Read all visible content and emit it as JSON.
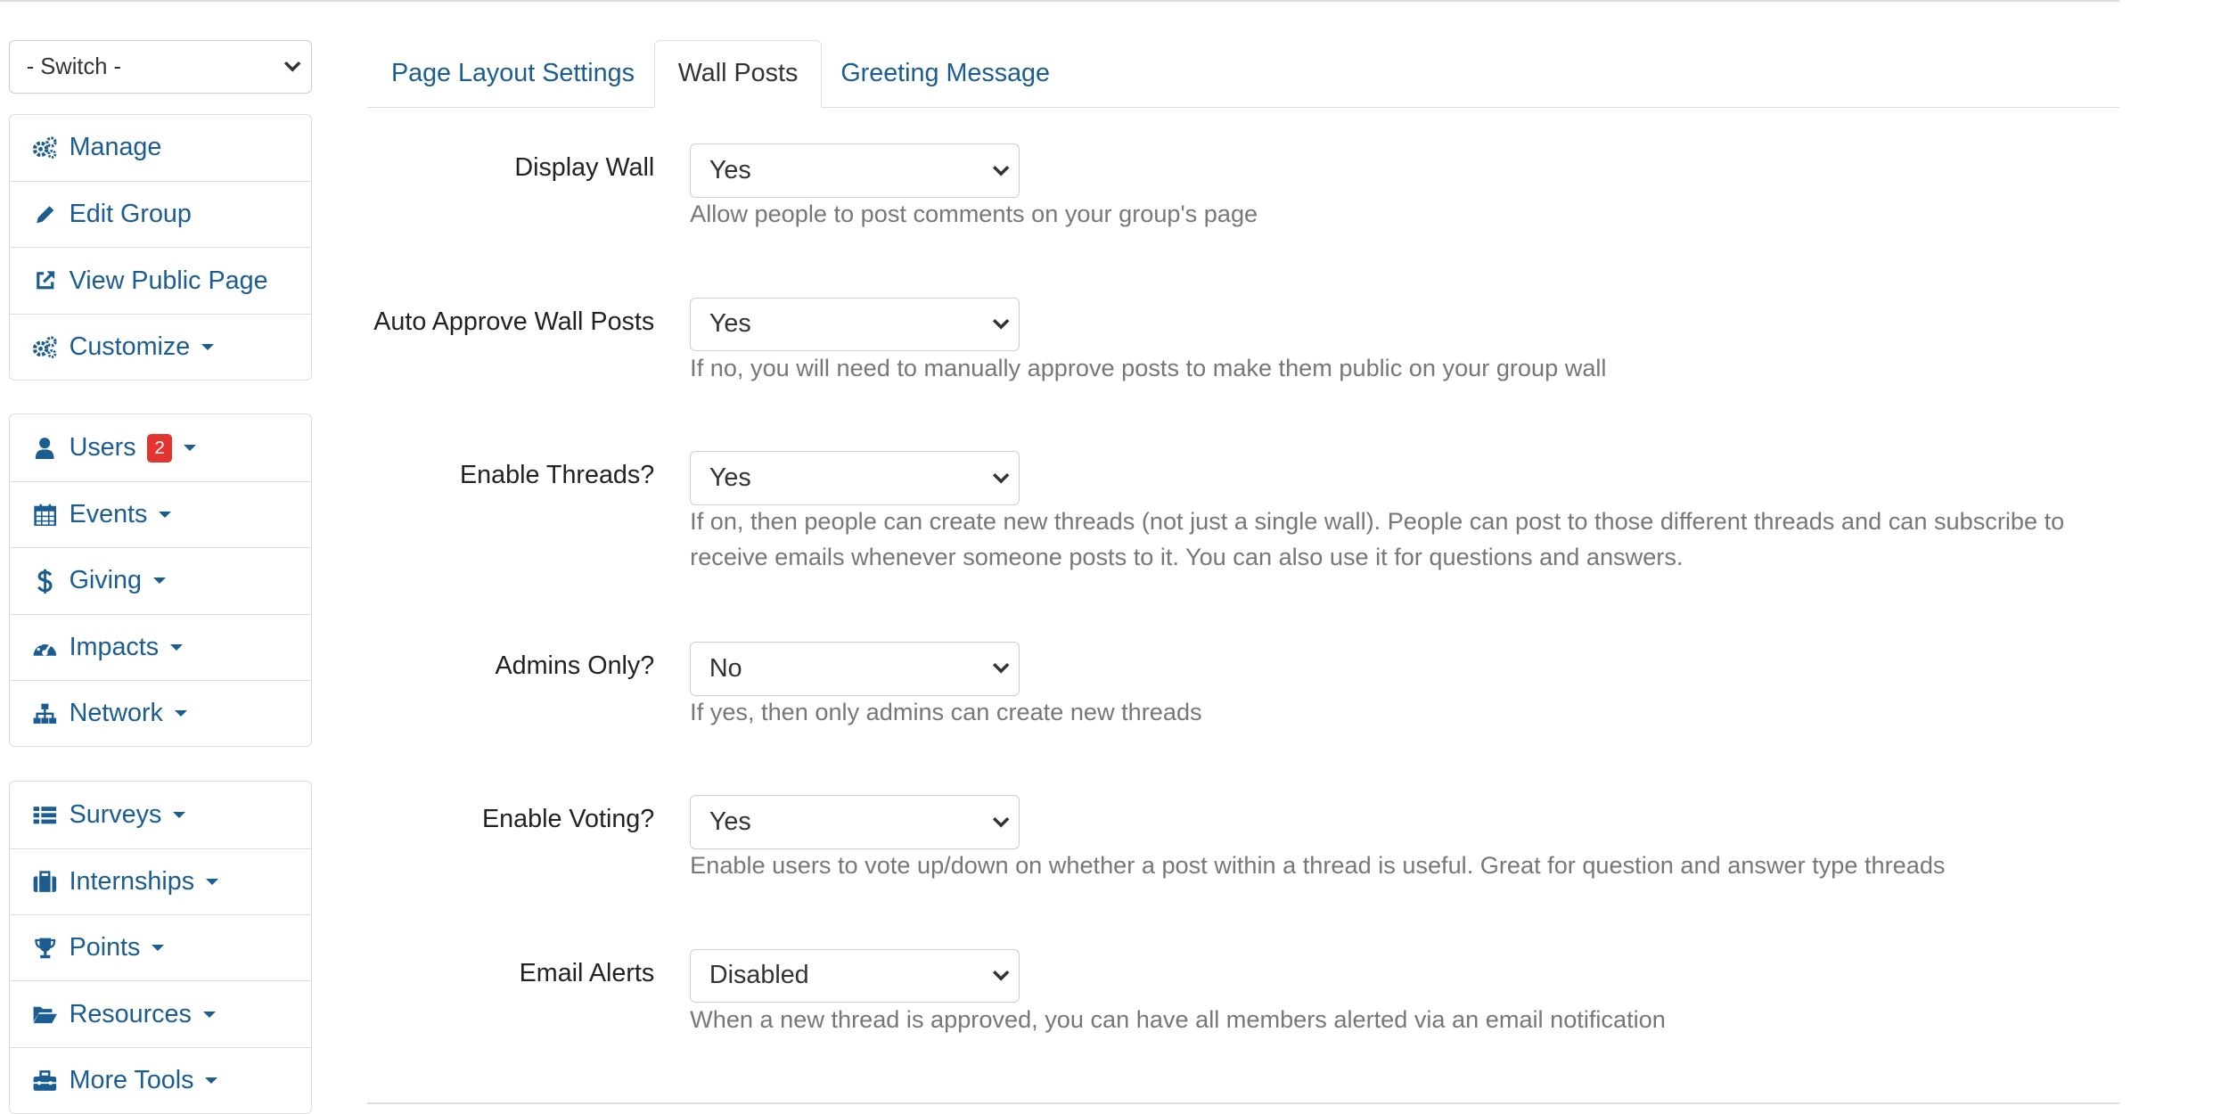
{
  "sidebar": {
    "switch_value": "- Switch -",
    "group1": [
      "Manage",
      "Edit Group",
      "View Public Page",
      "Customize"
    ],
    "group2": [
      "Users",
      "Events",
      "Giving",
      "Impacts",
      "Network"
    ],
    "users_badge": "2",
    "group3": [
      "Surveys",
      "Internships",
      "Points",
      "Resources",
      "More Tools"
    ],
    "icons": [
      "cogs-icon",
      "pencil-icon",
      "external-link-icon",
      "cogs-icon",
      "user-icon",
      "calendar-icon",
      "dollar-icon",
      "dashboard-icon",
      "sitemap-icon",
      "list-icon",
      "briefcase-icon",
      "trophy-icon",
      "folder-open-icon",
      "toolbox-icon"
    ]
  },
  "tabs": [
    "Page Layout Settings",
    "Wall Posts",
    "Greeting Message"
  ],
  "active_tab": "Wall Posts",
  "form": {
    "display_wall": {
      "label": "Display Wall",
      "value": "Yes",
      "help": "Allow people to post comments on your group's page"
    },
    "auto_approve": {
      "label": "Auto Approve Wall Posts",
      "value": "Yes",
      "help": "If no, you will need to manually approve posts to make them public on your group wall"
    },
    "enable_threads": {
      "label": "Enable Threads?",
      "value": "Yes",
      "help": "If on, then people can create new threads (not just a single wall). People can post to those different threads and can subscribe to receive emails whenever someone posts to it. You can also use it for questions and answers."
    },
    "admins_only": {
      "label": "Admins Only?",
      "value": "No",
      "help": "If yes, then only admins can create new threads"
    },
    "enable_voting": {
      "label": "Enable Voting?",
      "value": "Yes",
      "help": "Enable users to vote up/down on whether a post within a thread is useful. Great for question and answer type threads"
    },
    "email_alerts": {
      "label": "Email Alerts",
      "value": "Disabled",
      "help": "When a new thread is approved, you can have all members alerted via an email notification"
    }
  },
  "colors": {
    "link": "#1b5c91",
    "badge": "#e3342f",
    "help_text": "#777777",
    "border": "#dddddd"
  }
}
